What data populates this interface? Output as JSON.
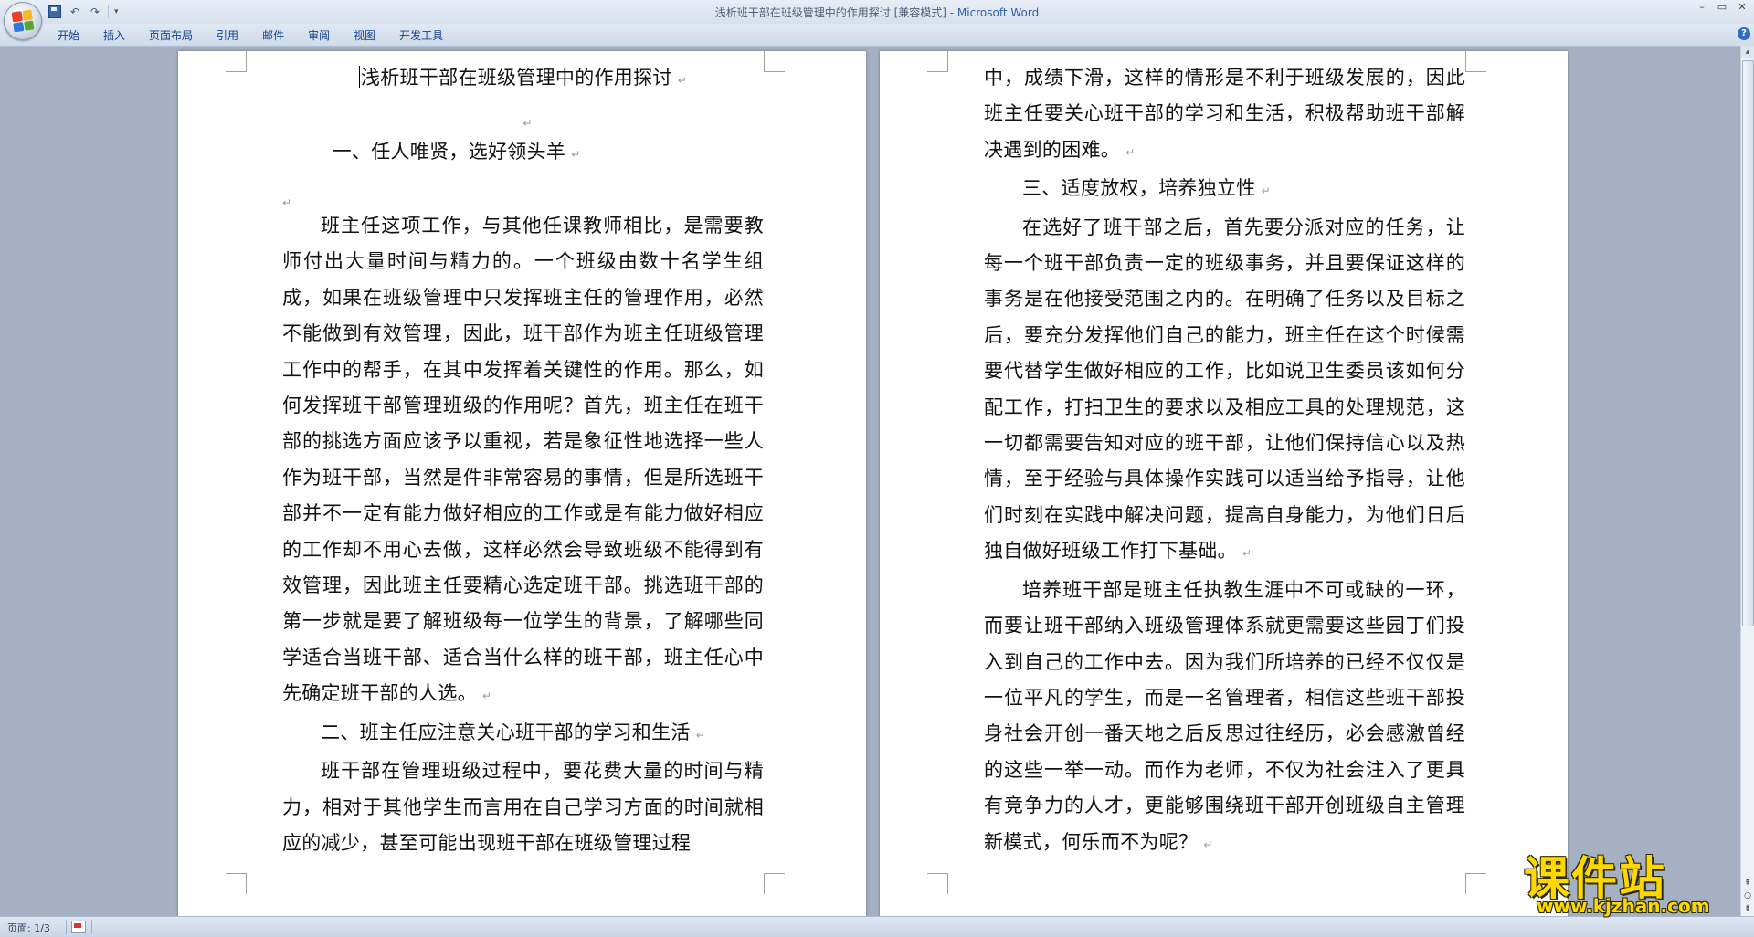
{
  "window": {
    "title_doc": "浅析班干部在班级管理中的作用探讨 [兼容模式] - ",
    "title_app": "Microsoft Word"
  },
  "qat": {
    "undo_glyph": "↶",
    "redo_glyph": "↷",
    "dropdown_glyph": "▾"
  },
  "win_controls": {
    "minimize": "–",
    "restore": "▭",
    "close": "✕"
  },
  "ribbon": {
    "tabs": [
      "开始",
      "插入",
      "页面布局",
      "引用",
      "邮件",
      "审阅",
      "视图",
      "开发工具"
    ],
    "help": "?"
  },
  "para_mark": "↵",
  "document": {
    "title": "浅析班干部在班级管理中的作用探讨",
    "section1": "一、任人唯贤，选好领头羊",
    "p1": "班主任这项工作，与其他任课教师相比，是需要教师付出大量时间与精力的。一个班级由数十名学生组成，如果在班级管理中只发挥班主任的管理作用，必然不能做到有效管理，因此，班干部作为班主任班级管理工作中的帮手，在其中发挥着关键性的作用。那么，如何发挥班干部管理班级的作用呢？首先，班主任在班干部的挑选方面应该予以重视，若是象征性地选择一些人作为班干部，当然是件非常容易的事情，但是所选班干部并不一定有能力做好相应的工作或是有能力做好相应的工作却不用心去做，这样必然会导致班级不能得到有效管理，因此班主任要精心选定班干部。挑选班干部的第一步就是要了解班级每一位学生的背景，了解哪些同学适合当班干部、适合当什么样的班干部，班主任心中先确定班干部的人选。",
    "section2": "二、班主任应注意关心班干部的学习和生活",
    "p2a": "班干部在管理班级过程中，要花费大量的时间与精力，相对于其他学生而言用在自己学习方面的时间就相应的减少，甚至可能出现班干部在班级管理过程",
    "p2b": "中，成绩下滑，这样的情形是不利于班级发展的，因此班主任要关心班干部的学习和生活，积极帮助班干部解决遇到的困难。",
    "section3": "三、适度放权，培养独立性",
    "p3": "在选好了班干部之后，首先要分派对应的任务，让每一个班干部负责一定的班级事务，并且要保证这样的事务是在他接受范围之内的。在明确了任务以及目标之后，要充分发挥他们自己的能力，班主任在这个时候需要代替学生做好相应的工作，比如说卫生委员该如何分配工作，打扫卫生的要求以及相应工具的处理规范，这一切都需要告知对应的班干部，让他们保持信心以及热情，至于经验与具体操作实践可以适当给予指导，让他们时刻在实践中解决问题，提高自身能力，为他们日后独自做好班级工作打下基础。",
    "p4": "培养班干部是班主任执教生涯中不可或缺的一环，而要让班干部纳入班级管理体系就更需要这些园丁们投入到自己的工作中去。因为我们所培养的已经不仅仅是一位平凡的学生，而是一名管理者，相信这些班干部投身社会开创一番天地之后反思过往经历，必会感激曾经的这些一举一动。而作为老师，不仅为社会注入了更具有竞争力的人才，更能够围绕班干部开创班级自主管理新模式，何乐而不为呢？"
  },
  "statusbar": {
    "page_info": "页面: 1/3"
  },
  "scrollbar": {
    "up": "▴",
    "prev": "⇞",
    "select": "○",
    "next": "⇟"
  },
  "watermark": {
    "text": "课件站",
    "url": "www.kjzhan.com"
  },
  "colors": {
    "office_logo": [
      "#e8402a",
      "#f7b82b",
      "#2d7bd6",
      "#56a632"
    ]
  }
}
